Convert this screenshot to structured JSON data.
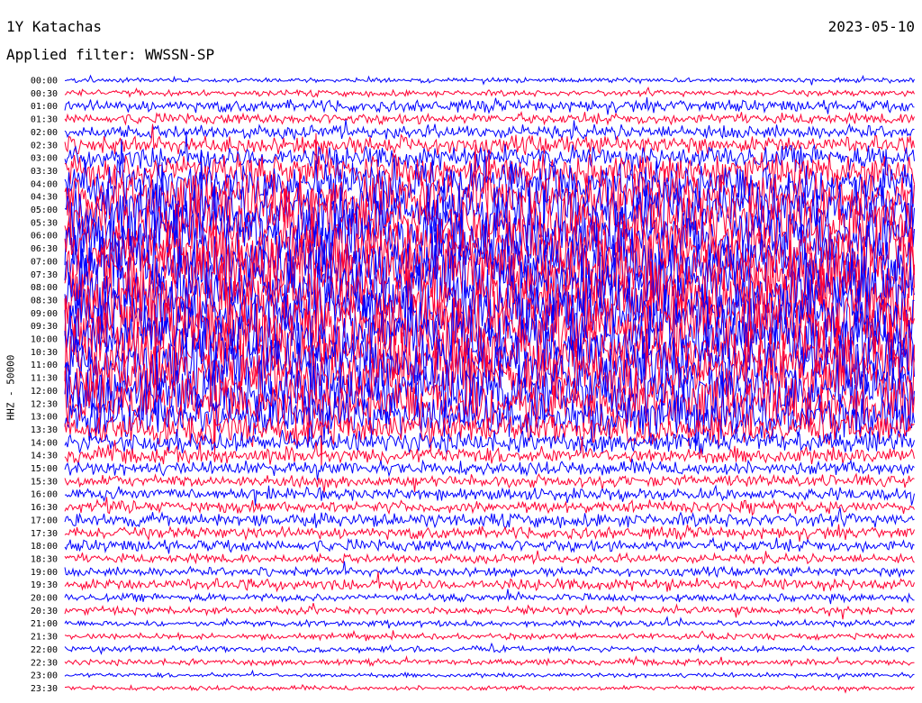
{
  "header": {
    "station": "1Y Katachas",
    "date": "2023-05-10",
    "filter": "Applied filter: WWSSN-SP"
  },
  "chart_data": {
    "type": "line",
    "subtype": "helicorder",
    "ylabel": "HHZ - 50000",
    "colors": [
      "#0000ff",
      "#ff0033"
    ],
    "rows": [
      {
        "label": "00:00",
        "amp": 3
      },
      {
        "label": "00:30",
        "amp": 4
      },
      {
        "label": "01:00",
        "amp": 8
      },
      {
        "label": "01:30",
        "amp": 7
      },
      {
        "label": "02:00",
        "amp": 9
      },
      {
        "label": "02:30",
        "amp": 12
      },
      {
        "label": "03:00",
        "amp": 16
      },
      {
        "label": "03:30",
        "amp": 22
      },
      {
        "label": "04:00",
        "amp": 30
      },
      {
        "label": "04:30",
        "amp": 34
      },
      {
        "label": "05:00",
        "amp": 38
      },
      {
        "label": "05:30",
        "amp": 40
      },
      {
        "label": "06:00",
        "amp": 42
      },
      {
        "label": "06:30",
        "amp": 44
      },
      {
        "label": "07:00",
        "amp": 46
      },
      {
        "label": "07:30",
        "amp": 48
      },
      {
        "label": "08:00",
        "amp": 48
      },
      {
        "label": "08:30",
        "amp": 47
      },
      {
        "label": "09:00",
        "amp": 46
      },
      {
        "label": "09:30",
        "amp": 45
      },
      {
        "label": "10:00",
        "amp": 45
      },
      {
        "label": "10:30",
        "amp": 44
      },
      {
        "label": "11:00",
        "amp": 43
      },
      {
        "label": "11:30",
        "amp": 42
      },
      {
        "label": "12:00",
        "amp": 40
      },
      {
        "label": "12:30",
        "amp": 36
      },
      {
        "label": "13:00",
        "amp": 30
      },
      {
        "label": "13:30",
        "amp": 20
      },
      {
        "label": "14:00",
        "amp": 14
      },
      {
        "label": "14:30",
        "amp": 11
      },
      {
        "label": "15:00",
        "amp": 9
      },
      {
        "label": "15:30",
        "amp": 8
      },
      {
        "label": "16:00",
        "amp": 8
      },
      {
        "label": "16:30",
        "amp": 8
      },
      {
        "label": "17:00",
        "amp": 9
      },
      {
        "label": "17:30",
        "amp": 8
      },
      {
        "label": "18:00",
        "amp": 8
      },
      {
        "label": "18:30",
        "amp": 6
      },
      {
        "label": "19:00",
        "amp": 6
      },
      {
        "label": "19:30",
        "amp": 8
      },
      {
        "label": "20:00",
        "amp": 5
      },
      {
        "label": "20:30",
        "amp": 5
      },
      {
        "label": "21:00",
        "amp": 4
      },
      {
        "label": "21:30",
        "amp": 4
      },
      {
        "label": "22:00",
        "amp": 4
      },
      {
        "label": "22:30",
        "amp": 4
      },
      {
        "label": "23:00",
        "amp": 3
      },
      {
        "label": "23:30",
        "amp": 3
      }
    ]
  }
}
